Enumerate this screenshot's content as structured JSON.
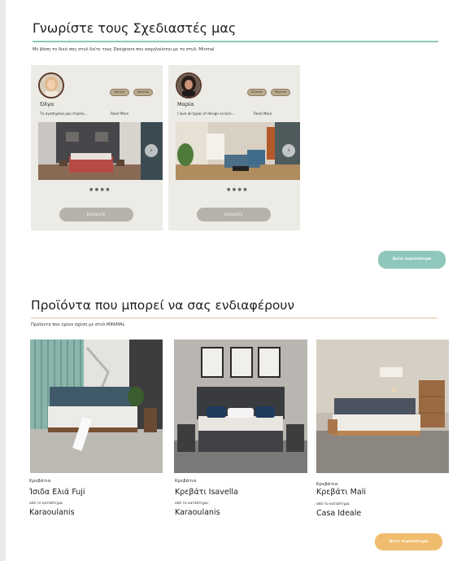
{
  "designers_section": {
    "title": "Γνωρίστε τους Σχεδιαστές μας",
    "subtitle": "Με βάση το δικό σας στυλ δείτε τους Designers που ασχολούνται με το στυλ: Minmal",
    "more_label": "Δείτε περισσότερα",
    "accent_color": "#8fc7bd",
    "designers": [
      {
        "name": "Όλγα",
        "bio": "Τα αγαπημένα μου στρίλο...",
        "read_more": "Read More",
        "tags": [
          "Natural",
          "Minimal"
        ],
        "dots": "● ● ● ●",
        "view_label": "ΕΠΙΛΕΧΤΕ"
      },
      {
        "name": "Μαρία",
        "bio": "I love all types of design so brin...",
        "read_more": "Read More",
        "tags": [
          "Eclectic",
          "Minimal"
        ],
        "dots": "● ● ● ●",
        "view_label": "ΕΠΙΛΕΧΤΕ"
      }
    ]
  },
  "products_section": {
    "title": "Προϊόντα που μπορεί να σας ενδιαφέρουν",
    "subtitle": "Προϊόντα που έχουν σχέση με στυλ MINIMAL",
    "more_label": "Δείτε περισσότερα",
    "accent_color": "#f0bd6e",
    "products": [
      {
        "category": "Κρεβάτια",
        "name": "Ίσιδα Ελιά Fuji",
        "from_label": "από το κατάστημα:",
        "shop": "Karaoulanis"
      },
      {
        "category": "Κρεβάτια",
        "name": "Κρεβάτι Isavella",
        "from_label": "από το κατάστημα:",
        "shop": "Karaoulanis"
      },
      {
        "category": "Κρεβάτια",
        "name": "Κρεβάτι Mali",
        "from_label": "από το κατάστημα:",
        "shop": "Casa Ideale"
      }
    ]
  }
}
